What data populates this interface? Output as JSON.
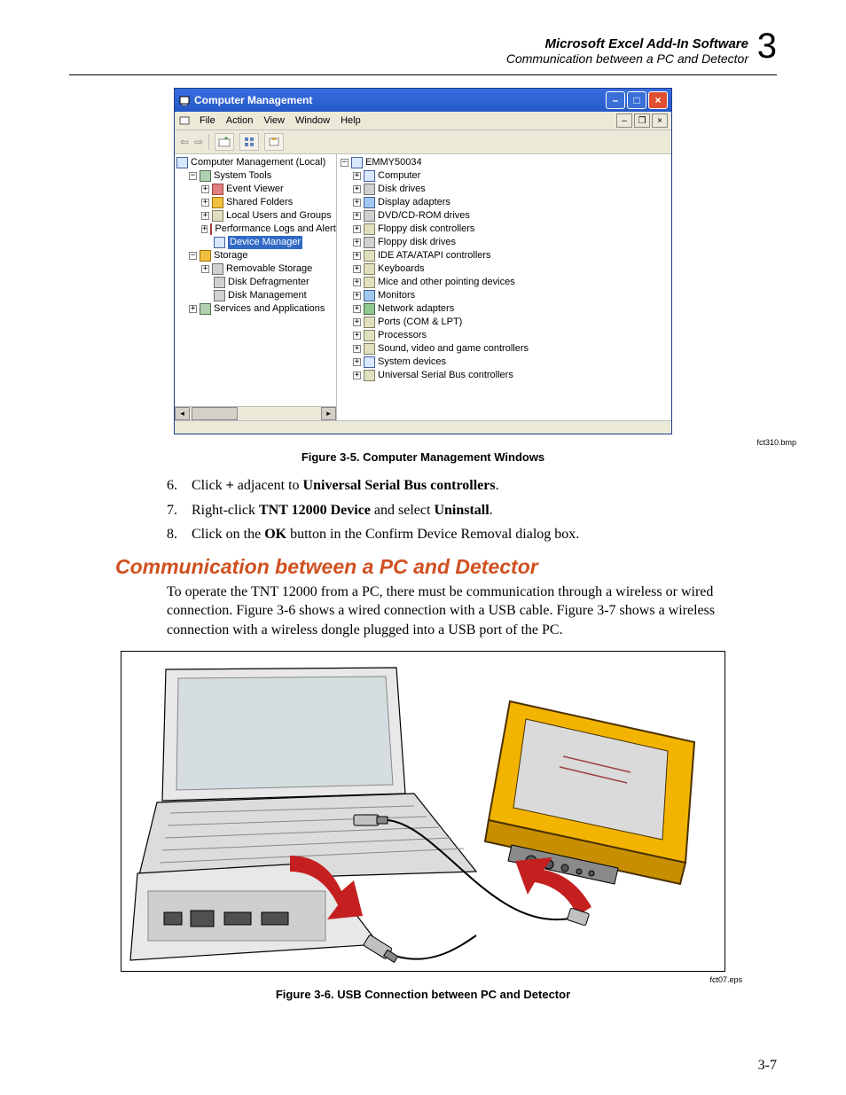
{
  "header": {
    "title": "Microsoft Excel Add-In Software",
    "subtitle": "Communication between a PC and Detector",
    "chapter": "3"
  },
  "window": {
    "title": "Computer Management",
    "menu": {
      "file": "File",
      "action": "Action",
      "view": "View",
      "window": "Window",
      "help": "Help"
    },
    "left_tree": {
      "root": "Computer Management (Local)",
      "system_tools": "System Tools",
      "event_viewer": "Event Viewer",
      "shared_folders": "Shared Folders",
      "local_users": "Local Users and Groups",
      "perf_logs": "Performance Logs and Alerts",
      "device_manager": "Device Manager",
      "storage": "Storage",
      "removable": "Removable Storage",
      "defrag": "Disk Defragmenter",
      "disk_mgmt": "Disk Management",
      "services": "Services and Applications"
    },
    "right_tree": {
      "root": "EMMY50034",
      "computer": "Computer",
      "disk_drives": "Disk drives",
      "display": "Display adapters",
      "dvd": "DVD/CD-ROM drives",
      "floppy_ctrl": "Floppy disk controllers",
      "floppy_drv": "Floppy disk drives",
      "ide": "IDE ATA/ATAPI controllers",
      "keyboards": "Keyboards",
      "mice": "Mice and other pointing devices",
      "monitors": "Monitors",
      "network": "Network adapters",
      "ports": "Ports (COM & LPT)",
      "processors": "Processors",
      "sound": "Sound, video and game controllers",
      "system_dev": "System devices",
      "usb": "Universal Serial Bus controllers"
    }
  },
  "figure1": {
    "filename": "fct310.bmp",
    "caption": "Figure 3-5. Computer Management Windows"
  },
  "steps": {
    "s6_num": "6.",
    "s6_a": "Click ",
    "s6_b": "+",
    "s6_c": " adjacent to ",
    "s6_d": "Universal Serial Bus controllers",
    "s6_e": ".",
    "s7_num": "7.",
    "s7_a": "Right-click ",
    "s7_b": "TNT 12000 Device",
    "s7_c": " and select ",
    "s7_d": "Uninstall",
    "s7_e": ".",
    "s8_num": "8.",
    "s8_a": "Click on the ",
    "s8_b": "OK",
    "s8_c": " button in the Confirm Device Removal dialog box."
  },
  "section": {
    "heading": "Communication between a PC and Detector",
    "para": "To operate the TNT 12000 from a PC, there must be communication through a wireless or wired connection. Figure 3-6 shows a wired connection with a USB cable. Figure 3-7 shows a wireless connection with a wireless dongle plugged into a USB port of the PC."
  },
  "figure2": {
    "filename": "fct07.eps",
    "caption": "Figure 3-6. USB Connection between PC and Detector"
  },
  "page_number": "3-7"
}
